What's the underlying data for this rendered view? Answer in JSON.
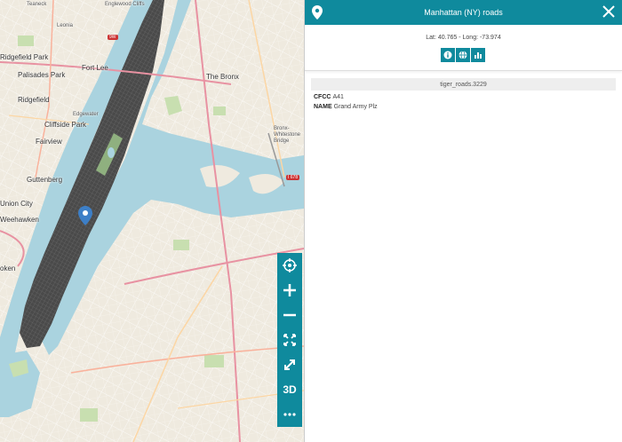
{
  "panel": {
    "title": "Manhattan (NY) roads",
    "coords": "Lat: 40.765 - Long: -73.974",
    "layer_id": "tiger_roads.3229",
    "attributes": [
      {
        "key": "CFCC",
        "value": "A41"
      },
      {
        "key": "NAME",
        "value": "Grand Army Plz"
      }
    ],
    "tools": [
      "info-icon",
      "globe-icon",
      "chart-icon"
    ],
    "header_icons": [
      "map-pin-icon",
      "close-icon"
    ]
  },
  "map_controls": {
    "buttons": [
      "crosshair-icon",
      "zoom-in-icon",
      "zoom-out-icon",
      "zoom-extent-icon",
      "fullscreen-icon",
      "3d",
      "more-icon"
    ],
    "three_d_label": "3D"
  },
  "map_labels": {
    "teaneck": "Teaneck",
    "englewood": "Englewood Cliffs",
    "leonia": "Leonia",
    "ridgefield_park": "Ridgefield Park",
    "palisades_park": "Palisades Park",
    "fort_lee": "Fort Lee",
    "ridgefield": "Ridgefield",
    "cliffside_park": "Cliffside Park",
    "edgewater": "Edgewater",
    "fairview": "Fairview",
    "guttenberg": "Guttenberg",
    "union_city": "Union City",
    "weehawken": "Weehawken",
    "hoboken": "oken",
    "the_bronx": "The Bronx",
    "bronx_whitestone": "Bronx-Whitestone Bridge",
    "shield_i678": "I 678",
    "shield_9w": "9W"
  },
  "colors": {
    "accent": "#0f8a9d",
    "land": "#efeadf",
    "water": "#aad3df",
    "manhattan": "#4a4a4a",
    "park": "#c8dfb0"
  }
}
